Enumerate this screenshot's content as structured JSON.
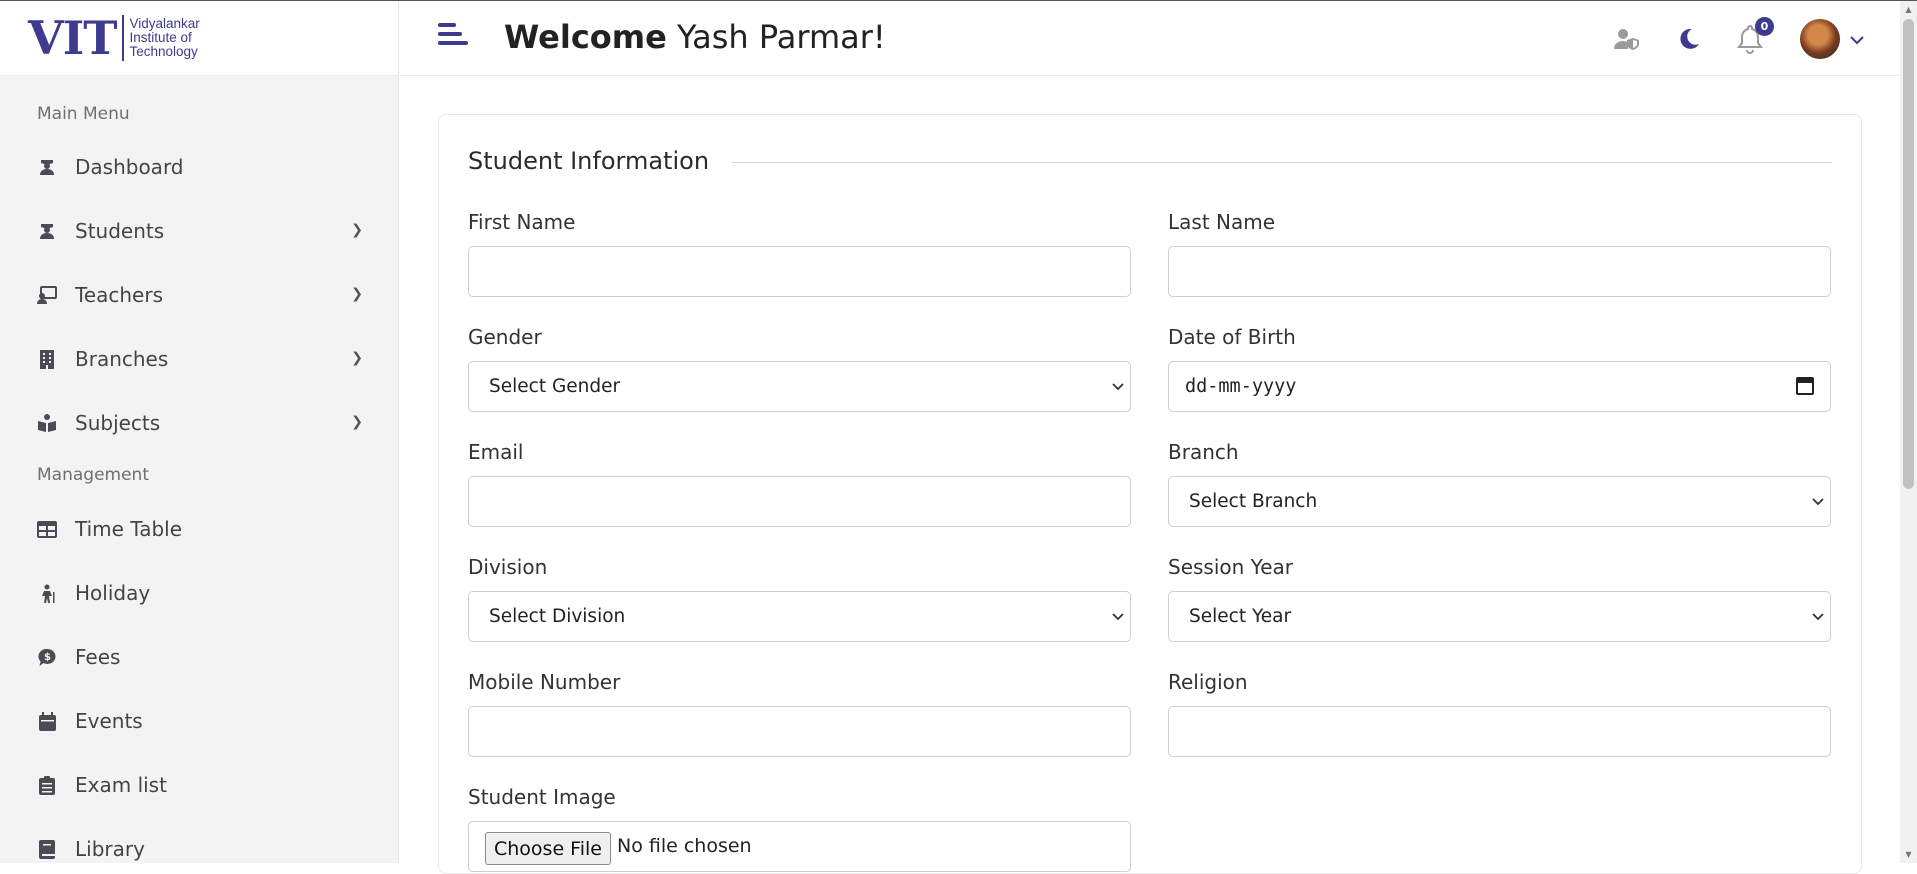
{
  "logo": {
    "main": "VIT",
    "line1": "Vidyalankar",
    "line2": "Institute of",
    "line3": "Technology"
  },
  "sidebar": {
    "main_menu_title": "Main Menu",
    "management_title": "Management",
    "items": [
      {
        "label": "Dashboard",
        "icon": "graduate-icon",
        "has_submenu": false
      },
      {
        "label": "Students",
        "icon": "graduate-icon",
        "has_submenu": true
      },
      {
        "label": "Teachers",
        "icon": "teacher-board-icon",
        "has_submenu": true
      },
      {
        "label": "Branches",
        "icon": "building-icon",
        "has_submenu": true
      },
      {
        "label": "Subjects",
        "icon": "book-reader-icon",
        "has_submenu": true
      },
      {
        "label": "Time Table",
        "icon": "table-icon",
        "has_submenu": false
      },
      {
        "label": "Holiday",
        "icon": "hiking-icon",
        "has_submenu": false
      },
      {
        "label": "Fees",
        "icon": "money-bubble-icon",
        "has_submenu": false
      },
      {
        "label": "Events",
        "icon": "calendar-icon",
        "has_submenu": false
      },
      {
        "label": "Exam list",
        "icon": "clipboard-list-icon",
        "has_submenu": false
      },
      {
        "label": "Library",
        "icon": "book-icon",
        "has_submenu": false
      }
    ]
  },
  "header": {
    "welcome_bold": "Welcome",
    "user_name": "Yash Parmar!",
    "notification_count": "0"
  },
  "form": {
    "section_title": "Student Information",
    "first_name_label": "First Name",
    "first_name_value": "",
    "last_name_label": "Last Name",
    "last_name_value": "",
    "gender_label": "Gender",
    "gender_selected": "Select Gender",
    "dob_label": "Date of Birth",
    "dob_placeholder": "dd-mm-yyyy",
    "email_label": "Email",
    "email_value": "",
    "branch_label": "Branch",
    "branch_selected": "Select Branch",
    "division_label": "Division",
    "division_selected": "Select Division",
    "session_label": "Session Year",
    "session_selected": "Select Year",
    "mobile_label": "Mobile Number",
    "mobile_value": "",
    "religion_label": "Religion",
    "religion_value": "",
    "image_label": "Student Image",
    "file_button": "Choose File",
    "file_status": "No file chosen"
  },
  "colors": {
    "brand": "#3d3b8e",
    "sidebar_bg": "#f3f3f4"
  }
}
